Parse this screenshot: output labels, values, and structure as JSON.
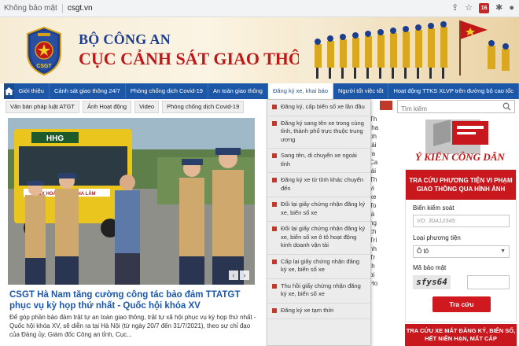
{
  "browser": {
    "security_label": "Không bảo mật",
    "url": "csgt.vn",
    "ext_badge": "16"
  },
  "header": {
    "title_line1": "BỘ CÔNG AN",
    "title_line2": "CỤC CẢNH SÁT GIAO THÔNG",
    "logo_text": "CSGT"
  },
  "main_nav": {
    "items": [
      "Giới thiệu",
      "Cảnh sát giao thông 24/7",
      "Phòng chống dịch Covid-19",
      "An toàn giao thông",
      "Đăng ký xe, khai báo",
      "Người tốt việc tốt",
      "Hoạt động TTKS XLVP trên đường bộ cao tốc"
    ]
  },
  "sub_nav": {
    "items": [
      "Văn bản pháp luật ATGT",
      "Ảnh Hoạt động",
      "Video",
      "Phòng chống dịch Covid-19"
    ]
  },
  "dropdown": {
    "items": [
      "Đăng ký, cấp biển số xe lần đầu",
      "Đăng ký sang tên xe trong cùng tỉnh, thành phố trực thuộc trung ương",
      "Sang tên, di chuyển xe ngoài tỉnh",
      "Đăng ký xe từ tỉnh khác chuyển đến",
      "Đổi lại giấy chứng nhận đăng ký xe, biển số xe",
      "Đổi lại giấy chứng nhận đăng ký xe, biển số xe ô tô hoạt động kinh doanh vận tải",
      "Cấp lại giấy chứng nhận đăng ký xe, biển số xe",
      "Thu hồi giấy chứng nhận đăng ký xe, biển số xe",
      "Đăng ký xe tạm thời"
    ]
  },
  "featured": {
    "bus_sign": "HHG",
    "bus_route": "BX HOÀNG HÀ - GIA LÂM",
    "headline": "CSGT Hà Nam tăng cường công tác bảo đảm TTATGT phục vụ kỳ họp thứ nhất - Quốc hội khóa XV",
    "summary": "Để góp phần bảo đảm trật tự an toàn giao thông, trật tự xã hội phục vụ kỳ họp thứ nhất - Quốc hội khóa XV, sẽ diễn ra tại Hà Nội (từ ngày 20/7 đến 31/7/2021), theo sự chỉ đạo của Đảng ủy, Giám đốc Công an tỉnh, Cục..."
  },
  "midcol": {
    "lines": [
      "Th",
      "tha",
      "ph",
      "tài",
      "ra",
      "Ca",
      "lái",
      "Th",
      "vi",
      "xe",
      "To",
      "lá",
      "ng",
      "ch",
      "Trí",
      "nh",
      "Tr",
      "th",
      "bị",
      "Ho"
    ]
  },
  "search": {
    "placeholder": "Tìm kiếm"
  },
  "banner": {
    "text": "Ý KIẾN CÔNG DÂN"
  },
  "lookup_form": {
    "heading": "TRA CỨU PHƯƠNG TIỆN VI PHẠM GIAO THÔNG QUA HÌNH ẢNH",
    "plate_label": "Biển kiểm soát",
    "plate_placeholder": "VD: 30A12345",
    "vehicle_label": "Loại phương tiện",
    "vehicle_value": "Ô tô",
    "captcha_label": "Mã bảo mật",
    "captcha_code": "sfys64",
    "submit_label": "Tra cứu"
  },
  "bottom_banner": {
    "text": "TRA CỨU XE MẤT ĐĂNG KÝ, BIỂN SỐ, HẾT NIÊN HẠN, MẤT CẮP"
  },
  "colors": {
    "nav_blue": "#1d57a8",
    "brand_red": "#c8171d",
    "title_blue": "#1d3e8f"
  }
}
